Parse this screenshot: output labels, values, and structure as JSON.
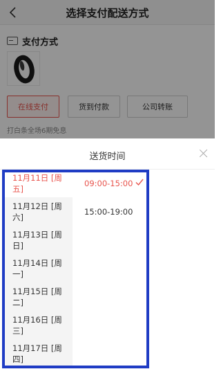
{
  "header": {
    "title": "选择支付配送方式"
  },
  "payment": {
    "section_title": "支付方式",
    "options": [
      {
        "label": "在线支付",
        "selected": true
      },
      {
        "label": "货到付款",
        "selected": false
      },
      {
        "label": "公司转账",
        "selected": false
      }
    ],
    "promo": "打白条全场6期免息"
  },
  "sheet": {
    "title": "送货时间",
    "dates": [
      {
        "label": "11月11日 [周五]",
        "selected": true
      },
      {
        "label": "11月12日 [周六]",
        "selected": false
      },
      {
        "label": "11月13日 [周日]",
        "selected": false
      },
      {
        "label": "11月14日 [周一]",
        "selected": false
      },
      {
        "label": "11月15日 [周二]",
        "selected": false
      },
      {
        "label": "11月16日 [周三]",
        "selected": false
      },
      {
        "label": "11月17日 [周四]",
        "selected": false
      }
    ],
    "times": [
      {
        "label": "09:00-15:00",
        "selected": true
      },
      {
        "label": "15:00-19:00",
        "selected": false
      }
    ]
  },
  "colors": {
    "accent": "#e8544d",
    "highlight": "#1f3cc4"
  },
  "icons": {
    "back": "back-arrow-icon",
    "close": "close-icon",
    "check": "check-icon",
    "card": "card-icon"
  }
}
